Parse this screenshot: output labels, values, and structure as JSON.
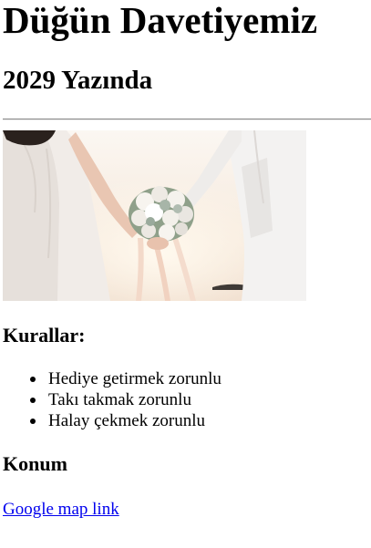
{
  "header": {
    "title": "Düğün Davetiyemiz",
    "subtitle": "2029 Yazında"
  },
  "photo": {
    "subject": "bride and groom holding hands with white rose bouquet"
  },
  "rules": {
    "heading": "Kurallar:",
    "items": [
      "Hediye getirmek zorunlu",
      "Takı takmak zorunlu",
      "Halay çekmek zorunlu"
    ]
  },
  "location": {
    "heading": "Konum",
    "link_label": "Google map link"
  },
  "colors": {
    "link": "#0000ee",
    "text": "#000000",
    "background": "#ffffff"
  }
}
